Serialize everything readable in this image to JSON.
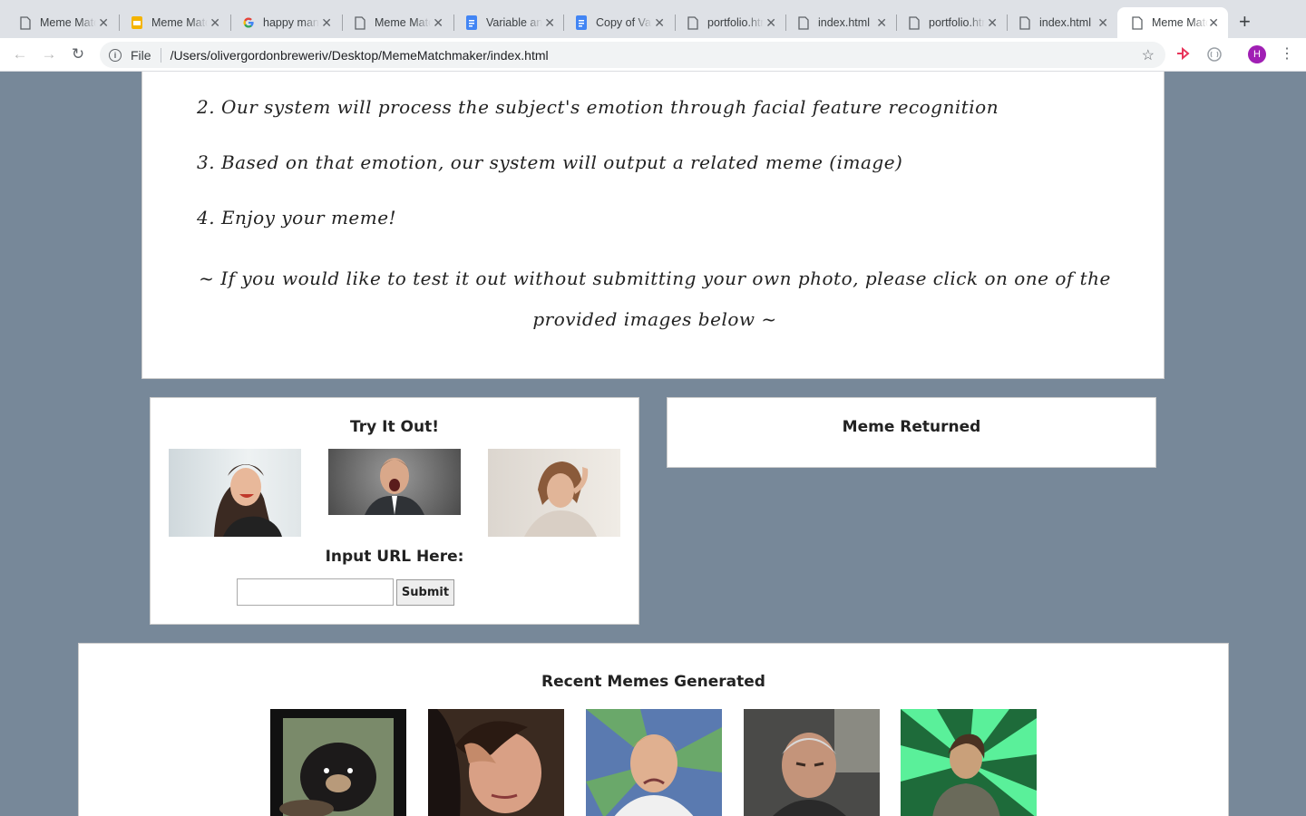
{
  "browser": {
    "tabs": [
      {
        "label": "Meme Matchmaker",
        "icon": "document-icon"
      },
      {
        "label": "Meme Matchmaker",
        "icon": "slides-icon"
      },
      {
        "label": "happy man",
        "icon": "google-icon"
      },
      {
        "label": "Meme Matchmaker",
        "icon": "document-icon"
      },
      {
        "label": "Variable and",
        "icon": "docs-icon"
      },
      {
        "label": "Copy of Variable",
        "icon": "docs-icon"
      },
      {
        "label": "portfolio.html",
        "icon": "document-icon"
      },
      {
        "label": "index.html",
        "icon": "document-icon"
      },
      {
        "label": "portfolio.html",
        "icon": "document-icon"
      },
      {
        "label": "index.html",
        "icon": "document-icon"
      },
      {
        "label": "Meme Matchmaker",
        "icon": "document-icon",
        "active": true
      }
    ],
    "file_label": "File",
    "url": "/Users/olivergordonbreweriv/Desktop/MemeMatchmaker/index.html",
    "profile_initial": "H"
  },
  "instructions": {
    "step2": "2. Our system will process the subject's emotion through facial feature recognition",
    "step3": "3. Based on that emotion, our system will output a related meme (image)",
    "step4": "4. Enjoy your meme!",
    "note": "~ If you would like to test it out without submitting your own photo, please click on one of the provided images below ~"
  },
  "try_it": {
    "title": "Try It Out!",
    "samples": [
      "happy woman",
      "angry man",
      "sad woman"
    ],
    "url_label": "Input URL Here:",
    "url_value": "",
    "submit_label": "Submit"
  },
  "meme_returned": {
    "title": "Meme Returned"
  },
  "recent": {
    "title": "Recent Memes Generated",
    "memes": [
      "confession bear",
      "first world problems",
      "crying dawson",
      "clint eastwood",
      "daryl dixon"
    ]
  },
  "colors": {
    "page_bg": "#778899",
    "card_bg": "#ffffff",
    "profile": "#a01fb4"
  }
}
